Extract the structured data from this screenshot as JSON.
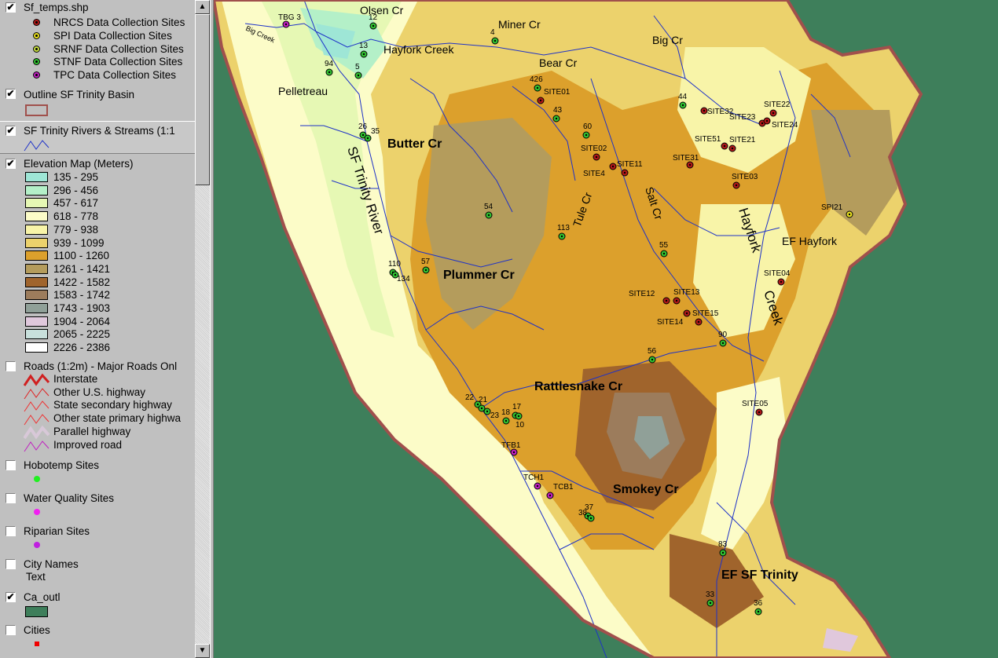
{
  "toc": {
    "groups": [
      {
        "id": "sf_temps",
        "name": "Sf_temps.shp",
        "checked": true,
        "items": [
          {
            "label": "NRCS Data Collection Sites",
            "color": "#b01818"
          },
          {
            "label": "SPI Data Collection Sites",
            "color": "#e8e020"
          },
          {
            "label": "SRNF Data Collection Sites",
            "color": "#c8e040"
          },
          {
            "label": "STNF Data Collection Sites",
            "color": "#30c030"
          },
          {
            "label": "TPC Data Collection Sites",
            "color": "#c020c0"
          }
        ]
      },
      {
        "id": "outline",
        "name": "Outline SF Trinity Basin",
        "checked": true
      },
      {
        "id": "rivers",
        "name": "SF Trinity Rivers & Streams (1:1",
        "checked": true
      },
      {
        "id": "elevation",
        "name": "Elevation Map (Meters)",
        "checked": true,
        "classes": [
          {
            "label": "135 - 295",
            "color": "#9ee6d6"
          },
          {
            "label": "296 - 456",
            "color": "#b4f0c8"
          },
          {
            "label": "457 - 617",
            "color": "#e6f8b4"
          },
          {
            "label": "618 - 778",
            "color": "#fcfcc8"
          },
          {
            "label": "779 - 938",
            "color": "#f8f4a8"
          },
          {
            "label": "939 - 1099",
            "color": "#ecd26c"
          },
          {
            "label": "1100 - 1260",
            "color": "#dca02c"
          },
          {
            "label": "1261 - 1421",
            "color": "#b49c5c"
          },
          {
            "label": "1422 - 1582",
            "color": "#a0642c"
          },
          {
            "label": "1583 - 1742",
            "color": "#9c7c5c"
          },
          {
            "label": "1743 - 1903",
            "color": "#90a098"
          },
          {
            "label": "1904 - 2064",
            "color": "#e0c8dc"
          },
          {
            "label": "2065 - 2225",
            "color": "#c8e0dc"
          },
          {
            "label": "2226 - 2386",
            "color": "#ffffff"
          }
        ]
      },
      {
        "id": "roads",
        "name": "Roads (1:2m) - Major Roads Onl",
        "checked": false,
        "items": [
          {
            "label": "Interstate",
            "color": "#d02020"
          },
          {
            "label": "Other U.S. highway",
            "color": "#e02020"
          },
          {
            "label": "State secondary highway",
            "color": "#f03030"
          },
          {
            "label": "Other state primary highwa",
            "color": "#f03030"
          },
          {
            "label": "Parallel highway",
            "color": "#d8c8d8"
          },
          {
            "label": "Improved road",
            "color": "#c020c0"
          }
        ]
      },
      {
        "id": "hobotemp",
        "name": "Hobotemp Sites",
        "checked": false,
        "color": "#20f020"
      },
      {
        "id": "waterq",
        "name": "Water Quality Sites",
        "checked": false,
        "color": "#f020f0"
      },
      {
        "id": "riparian",
        "name": "Riparian Sites",
        "checked": false,
        "color": "#c020e0"
      },
      {
        "id": "city_names",
        "name": "City Names",
        "checked": false,
        "sample": "Text"
      },
      {
        "id": "ca_outl",
        "name": "Ca_outl",
        "checked": true,
        "color": "#3e7f5b"
      },
      {
        "id": "cities",
        "name": "Cities",
        "checked": false,
        "color": "#f00000"
      }
    ],
    "check_mark": "✔"
  },
  "scrollbar": {
    "up_arrow": "▲",
    "down_arrow": "▼"
  },
  "map": {
    "colors": {
      "background": "#3e7f5b",
      "basin_outline": "#a0504c",
      "streams": "#1e32c8",
      "nrcs": "#b01818",
      "stnf": "#30c030",
      "tpc": "#c020c0",
      "spi": "#e8e020"
    },
    "place_labels": [
      {
        "text": "Olsen Cr",
        "size": "small"
      },
      {
        "text": "Miner Cr",
        "size": "small"
      },
      {
        "text": "Big Cr",
        "size": "small"
      },
      {
        "text": "Hayfork Creek",
        "size": "small"
      },
      {
        "text": "Bear Cr",
        "size": "small"
      },
      {
        "text": "Pelletreau",
        "size": "small"
      },
      {
        "text": "Big Creek",
        "size": "tiny"
      },
      {
        "text": "Butter Cr",
        "size": "bold"
      },
      {
        "text": "SF Trinity River",
        "size": "large"
      },
      {
        "text": "Plummer Cr",
        "size": "bold"
      },
      {
        "text": "Tule Cr",
        "size": "small"
      },
      {
        "text": "Salt Cr",
        "size": "small"
      },
      {
        "text": "Hayfork",
        "size": "large"
      },
      {
        "text": "Creek",
        "size": "large"
      },
      {
        "text": "EF Hayfork",
        "size": "small"
      },
      {
        "text": "Rattlesnake Cr",
        "size": "bold"
      },
      {
        "text": "Smokey Cr",
        "size": "bold"
      },
      {
        "text": "EF SF Trinity",
        "size": "bold"
      }
    ],
    "sites": [
      {
        "label": "TBG 3",
        "type": "tpc"
      },
      {
        "label": "12",
        "type": "stnf"
      },
      {
        "label": "4",
        "type": "stnf"
      },
      {
        "label": "13",
        "type": "stnf"
      },
      {
        "label": "94",
        "type": "stnf"
      },
      {
        "label": "5",
        "type": "stnf"
      },
      {
        "label": "426",
        "type": "stnf"
      },
      {
        "label": "SITE01",
        "type": "nrcs"
      },
      {
        "label": "43",
        "type": "stnf"
      },
      {
        "label": "44",
        "type": "stnf"
      },
      {
        "label": "SITE32",
        "type": "nrcs"
      },
      {
        "label": "SITE22",
        "type": "nrcs"
      },
      {
        "label": "SITE23",
        "type": "nrcs"
      },
      {
        "label": "SITE24",
        "type": "nrcs"
      },
      {
        "label": "60",
        "type": "stnf"
      },
      {
        "label": "26",
        "type": "stnf"
      },
      {
        "label": "35",
        "type": "stnf"
      },
      {
        "label": "SITE51",
        "type": "nrcs"
      },
      {
        "label": "SITE21",
        "type": "nrcs"
      },
      {
        "label": "SITE02",
        "type": "nrcs"
      },
      {
        "label": "SITE31",
        "type": "nrcs"
      },
      {
        "label": "SITE4",
        "type": "nrcs"
      },
      {
        "label": "SITE11",
        "type": "nrcs"
      },
      {
        "label": "SITE03",
        "type": "nrcs"
      },
      {
        "label": "54",
        "type": "stnf"
      },
      {
        "label": "SPI21",
        "type": "spi"
      },
      {
        "label": "113",
        "type": "stnf"
      },
      {
        "label": "55",
        "type": "stnf"
      },
      {
        "label": "57",
        "type": "stnf"
      },
      {
        "label": "110",
        "type": "stnf"
      },
      {
        "label": "134",
        "type": "stnf"
      },
      {
        "label": "SITE04",
        "type": "nrcs"
      },
      {
        "label": "SITE12",
        "type": "nrcs"
      },
      {
        "label": "SITE13",
        "type": "nrcs"
      },
      {
        "label": "SITE14",
        "type": "nrcs"
      },
      {
        "label": "SITE15",
        "type": "nrcs"
      },
      {
        "label": "90",
        "type": "stnf"
      },
      {
        "label": "56",
        "type": "stnf"
      },
      {
        "label": "22",
        "type": "stnf"
      },
      {
        "label": "21",
        "type": "stnf"
      },
      {
        "label": "23",
        "type": "stnf"
      },
      {
        "label": "18",
        "type": "stnf"
      },
      {
        "label": "17",
        "type": "stnf"
      },
      {
        "label": "10",
        "type": "stnf"
      },
      {
        "label": "SITE05",
        "type": "nrcs"
      },
      {
        "label": "TFB1",
        "type": "tpc"
      },
      {
        "label": "TCH1",
        "type": "tpc"
      },
      {
        "label": "TCB1",
        "type": "tpc"
      },
      {
        "label": "37",
        "type": "stnf"
      },
      {
        "label": "38",
        "type": "stnf"
      },
      {
        "label": "83",
        "type": "stnf"
      },
      {
        "label": "33",
        "type": "stnf"
      },
      {
        "label": "36",
        "type": "stnf"
      }
    ]
  }
}
